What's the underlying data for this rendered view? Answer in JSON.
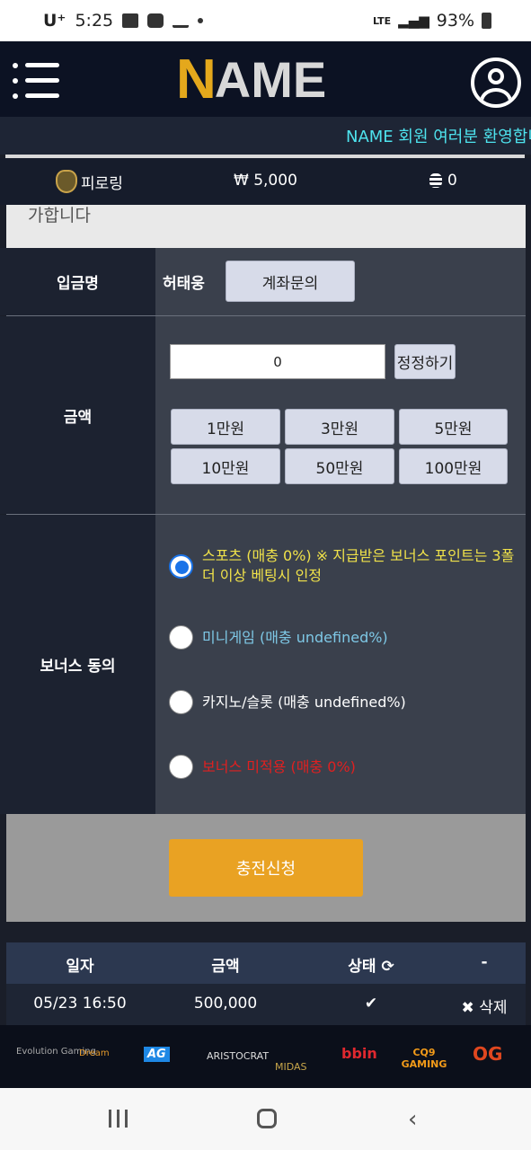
{
  "status_bar": {
    "carrier": "U⁺",
    "time": "5:25",
    "network": "LTE",
    "battery": "93%"
  },
  "header": {
    "logo_first": "N",
    "logo_rest": "AME"
  },
  "marquee": "NAME 회원 여러분 환영합니다",
  "user_info": {
    "level": "피로링",
    "money": "₩ 5,000",
    "points": "0"
  },
  "notice": "가합니다",
  "form": {
    "depositor_label": "입금명",
    "depositor_name": "허태웅",
    "account_inquiry": "계좌문의",
    "amount_label": "금액",
    "amount_value": "0",
    "reset": "정정하기",
    "quick_amounts": [
      "1만원",
      "3만원",
      "5만원",
      "10만원",
      "50만원",
      "100만원"
    ],
    "bonus_label": "보너스 동의",
    "bonus_options": [
      {
        "text": "스포츠 (매충 0%) ※ 지급받은 보너스 포인트는 3폴더 이상 베팅시 인정",
        "color": "#f0e24a",
        "checked": true
      },
      {
        "text": "미니게임 (매충 undefined%)",
        "color": "#7ec8e6",
        "checked": false
      },
      {
        "text": "카지노/슬롯 (매충 undefined%)",
        "color": "#ffffff",
        "checked": false
      },
      {
        "text": "보너스 미적용 (매충 0%)",
        "color": "#e02020",
        "checked": false
      }
    ],
    "submit": "충전신청"
  },
  "history": {
    "headers": [
      "일자",
      "금액",
      "상태",
      "-"
    ],
    "rows": [
      {
        "date": "05/23 16:50",
        "amount": "500,000",
        "status": "✔",
        "action": "삭제"
      }
    ]
  },
  "providers": [
    "Evolution Gaming",
    "Dream",
    "AG",
    "ARISTOCRAT",
    "MIDAS",
    "bbin",
    "CQ9 GAMING",
    "OG"
  ]
}
